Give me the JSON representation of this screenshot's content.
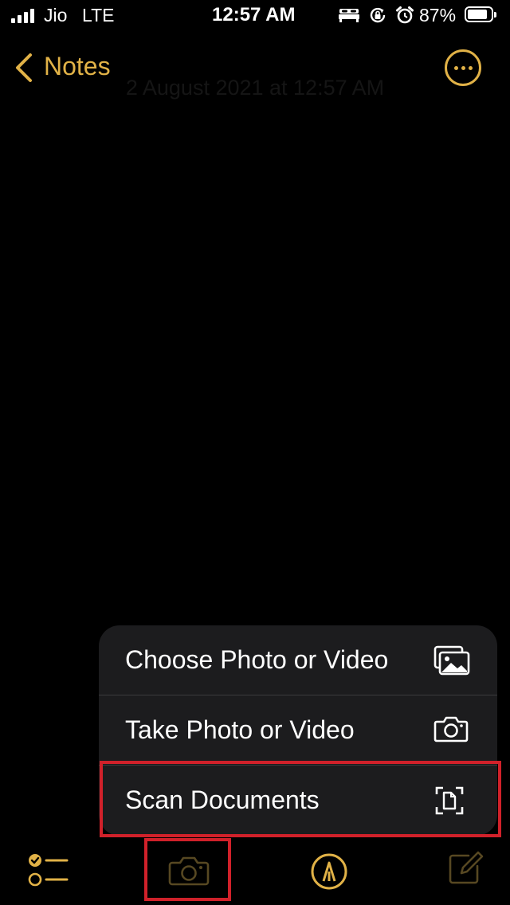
{
  "status_bar": {
    "carrier": "Jio",
    "network": "LTE",
    "time": "12:57 AM",
    "battery_percent": "87%",
    "battery_level": 0.87,
    "icons": [
      "bed-icon",
      "orientation-lock-icon",
      "alarm-icon"
    ]
  },
  "nav": {
    "back_label": "Notes",
    "more_icon": "ellipsis-circle-icon"
  },
  "note": {
    "date": "2 August 2021 at 12:57 AM"
  },
  "camera_menu": {
    "items": [
      {
        "label": "Choose Photo or Video",
        "icon": "photo-library-icon"
      },
      {
        "label": "Take Photo or Video",
        "icon": "camera-icon"
      },
      {
        "label": "Scan Documents",
        "icon": "doc-scanner-icon"
      }
    ]
  },
  "toolbar": {
    "items": [
      {
        "icon": "checklist-icon"
      },
      {
        "icon": "camera-icon"
      },
      {
        "icon": "markup-pen-icon"
      },
      {
        "icon": "compose-icon"
      }
    ]
  },
  "colors": {
    "accent": "#e1b247",
    "background": "#000000",
    "menu_background": "#1c1c1e",
    "highlight": "#d0212a"
  }
}
